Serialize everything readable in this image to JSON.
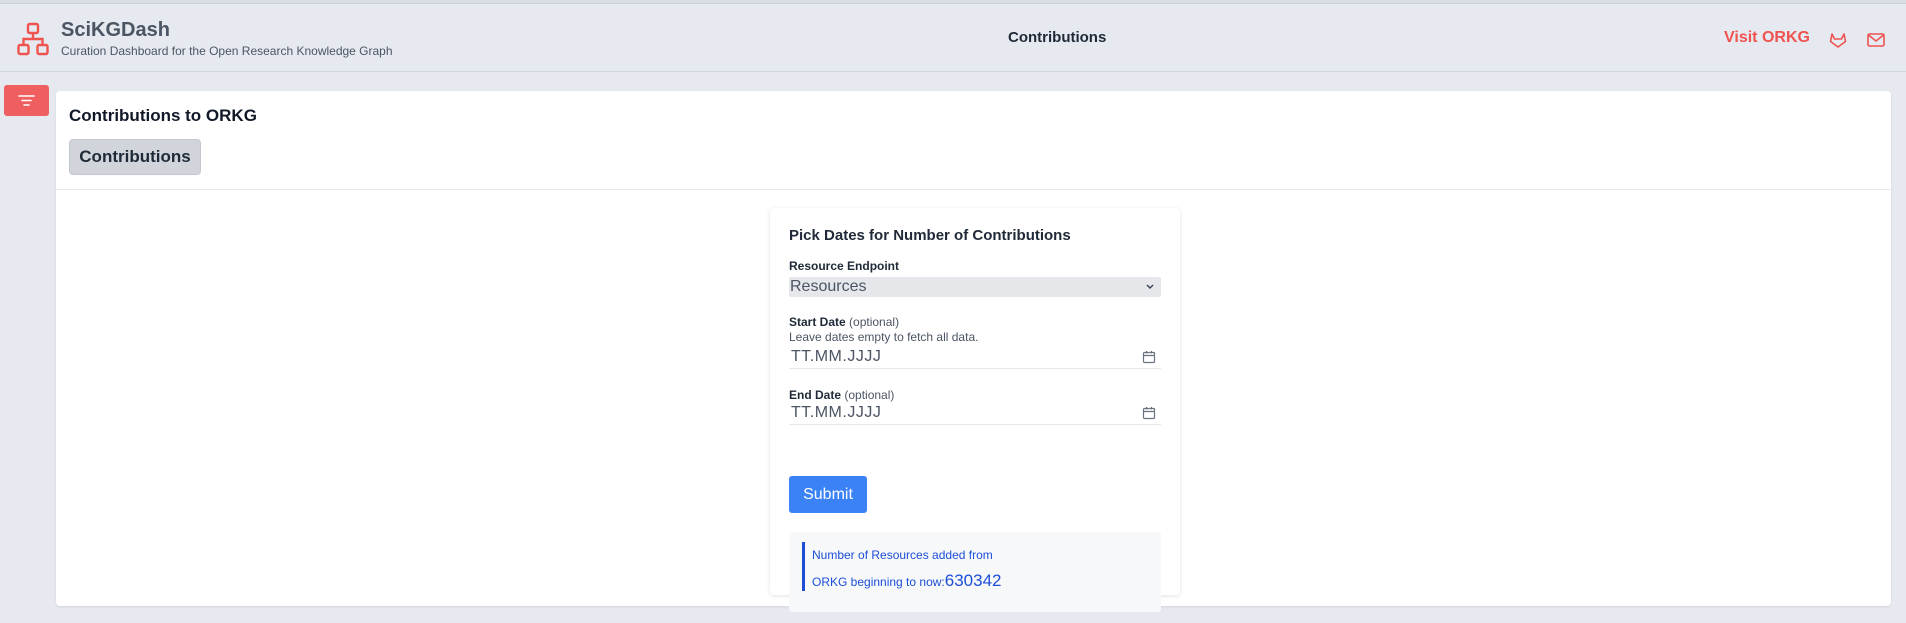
{
  "header": {
    "brand_title": "SciKGDash",
    "brand_subtitle": "Curation Dashboard for the Open Research Knowledge Graph",
    "nav_center": "Contributions",
    "visit_link": "Visit ORKG"
  },
  "icons": {
    "logo": "sitemap-icon",
    "menu": "hamburger-menu-icon",
    "gitlab": "gitlab-icon",
    "mail": "mail-icon",
    "select_chevron": "chevron-down-icon",
    "calendar": "calendar-icon"
  },
  "colors": {
    "accent": "#ef5350",
    "primary": "#3b82f6",
    "result_text": "#1d4ed8",
    "background": "#e6e9f0"
  },
  "card": {
    "title": "Contributions to ORKG",
    "tab_label": "Contributions"
  },
  "form": {
    "title": "Pick Dates for Number of Contributions",
    "endpoint_label": "Resource Endpoint",
    "endpoint_value": "Resources",
    "start_label": "Start Date",
    "start_optional": "(optional)",
    "hint": "Leave dates empty to fetch all data.",
    "start_placeholder": "TT.MM.JJJJ",
    "end_label": "End Date",
    "end_optional": "(optional)",
    "end_placeholder": "TT.MM.JJJJ",
    "submit_label": "Submit"
  },
  "result": {
    "line1": "Number of Resources added from",
    "line2": "ORKG beginning to now:",
    "count": "630342"
  }
}
